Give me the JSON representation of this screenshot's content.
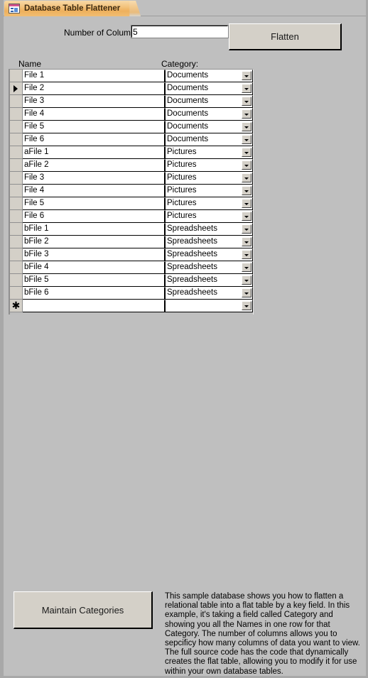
{
  "window": {
    "tab": {
      "label": "Database Table Flattener",
      "icon": "form-icon"
    }
  },
  "toolbar": {
    "columns_label": "Number of Columns:",
    "columns_value": "5",
    "columns_placeholder": "",
    "flatten_label": "Flatten"
  },
  "grid": {
    "headers": {
      "name": "Name",
      "category": "Category:"
    },
    "current_row_index": 1,
    "rows": [
      {
        "name": "File 1",
        "category": "Documents"
      },
      {
        "name": "File 2",
        "category": "Documents"
      },
      {
        "name": "File 3",
        "category": "Documents"
      },
      {
        "name": "File 4",
        "category": "Documents"
      },
      {
        "name": "File 5",
        "category": "Documents"
      },
      {
        "name": "File 6",
        "category": "Documents"
      },
      {
        "name": "aFile 1",
        "category": "Pictures"
      },
      {
        "name": "aFile 2",
        "category": "Pictures"
      },
      {
        "name": "File 3",
        "category": "Pictures"
      },
      {
        "name": "File 4",
        "category": "Pictures"
      },
      {
        "name": "File 5",
        "category": "Pictures"
      },
      {
        "name": "File 6",
        "category": "Pictures"
      },
      {
        "name": "bFile 1",
        "category": "Spreadsheets"
      },
      {
        "name": "bFile 2",
        "category": "Spreadsheets"
      },
      {
        "name": "bFile 3",
        "category": "Spreadsheets"
      },
      {
        "name": "bFile 4",
        "category": "Spreadsheets"
      },
      {
        "name": "bFile 5",
        "category": "Spreadsheets"
      },
      {
        "name": "bFile 6",
        "category": "Spreadsheets"
      },
      {
        "name": "",
        "category": "",
        "new_record": true
      }
    ],
    "new_record_marker": "✱"
  },
  "footer": {
    "maintain_categories_label": "Maintain Categories",
    "description": "This sample database shows you how to flatten a relational table into a flat table by a key field.  In this example, it's taking a field called Category and showing you all the Names in one row for that Category.  The number of columns allows you to sepcificy how many columns of data you want to view.  The full source code has the code that dynamically creates the flat table, allowing you to modify it for use within your own database tables."
  },
  "colors": {
    "form_background": "#bfbfbf",
    "button_face": "#d4d0c8",
    "tab_accent": "#eeb05c",
    "cell_background": "#ffffff"
  }
}
